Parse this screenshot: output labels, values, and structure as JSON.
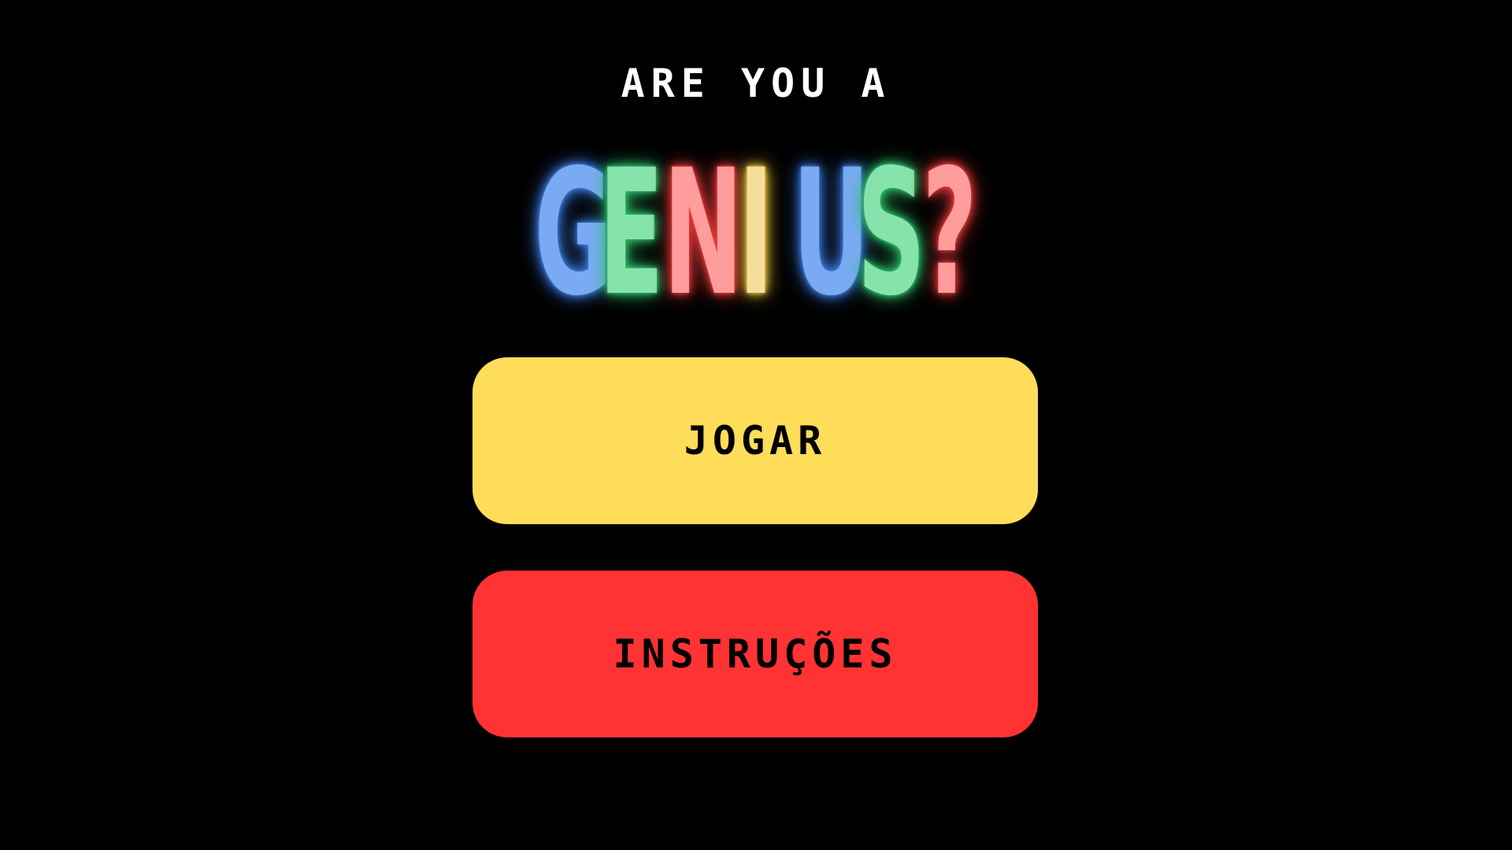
{
  "screen": {
    "subtitle": "ARE YOU A",
    "title_letters": [
      {
        "char": "G",
        "color": "#7aaaf2",
        "glow": "#3d7be0"
      },
      {
        "char": "E",
        "color": "#86e3ac",
        "glow": "#2fbf6a"
      },
      {
        "char": "N",
        "color": "#ff9c9c",
        "glow": "#e83a3a"
      },
      {
        "char": "I",
        "color": "#f4df9a",
        "glow": "#e8c23a"
      },
      {
        "char": "U",
        "color": "#7aaaf2",
        "glow": "#3d7be0"
      },
      {
        "char": "S",
        "color": "#86e3ac",
        "glow": "#2fbf6a"
      },
      {
        "char": "?",
        "color": "#ff9c9c",
        "glow": "#e83a3a"
      }
    ]
  },
  "buttons": {
    "play": {
      "label": "JOGAR",
      "color": "#ffdd59"
    },
    "instructions": {
      "label": "INSTRUÇÕES",
      "color": "#ff3333"
    }
  }
}
